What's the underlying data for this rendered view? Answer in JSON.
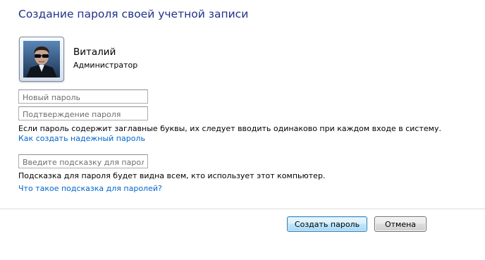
{
  "dialog": {
    "title": "Создание пароля своей учетной записи"
  },
  "user": {
    "name": "Виталий",
    "role": "Администратор",
    "avatar_icon": "user-photo-icon"
  },
  "form": {
    "new_password_placeholder": "Новый пароль",
    "confirm_password_placeholder": "Подтверждение пароля",
    "caps_notice": "Если пароль содержит заглавные буквы, их следует вводить одинаково при каждом входе в систему.",
    "strong_password_link": "Как создать надежный пароль",
    "hint_placeholder": "Введите подсказку для пароля",
    "hint_notice": "Подсказка для пароля будет видна всем, кто использует этот компьютер.",
    "hint_help_link": "Что такое подсказка для паролей?"
  },
  "buttons": {
    "create_label": "Создать пароль",
    "cancel_label": "Отмена"
  },
  "colors": {
    "title": "#1e3287",
    "link": "#0066cc",
    "default_button_border": "#3c7fb1"
  }
}
